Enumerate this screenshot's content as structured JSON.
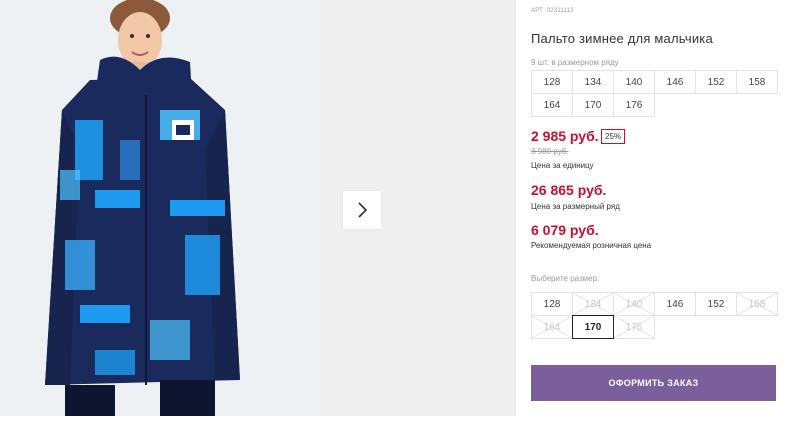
{
  "product": {
    "article": "АРТ: 32311113",
    "title": "Пальто зимнее для мальчика",
    "pack_note": "9 шт. в размерном ряду"
  },
  "pack_sizes": [
    "128",
    "134",
    "140",
    "146",
    "152",
    "158",
    "164",
    "170",
    "176"
  ],
  "pricing": {
    "unit_price": "2 985 руб.",
    "discount": "25%",
    "old_price": "3 980 руб.",
    "unit_note": "Цена за единицу",
    "pack_price": "26 865 руб.",
    "pack_note": "Цена за размерный ряд",
    "retail_price": "6 079 руб.",
    "retail_note": "Рекомендуемая розничная цена"
  },
  "size_select": {
    "label": "Выберите размер:",
    "options": [
      {
        "label": "128",
        "available": true,
        "selected": false
      },
      {
        "label": "134",
        "available": false,
        "selected": false
      },
      {
        "label": "140",
        "available": false,
        "selected": false
      },
      {
        "label": "146",
        "available": true,
        "selected": false
      },
      {
        "label": "152",
        "available": true,
        "selected": false
      },
      {
        "label": "158",
        "available": false,
        "selected": false
      },
      {
        "label": "164",
        "available": false,
        "selected": false
      },
      {
        "label": "170",
        "available": true,
        "selected": true
      },
      {
        "label": "176",
        "available": false,
        "selected": false
      }
    ]
  },
  "actions": {
    "order_label": "ОФОРМИТЬ ЗАКАЗ"
  },
  "gallery": {
    "next_icon": "chevron-right-icon"
  },
  "colors": {
    "accent": "#7a5f9c",
    "price_red": "#c8102e",
    "coat_navy": "#1b2a5c",
    "coat_blue": "#1e9bf0"
  }
}
